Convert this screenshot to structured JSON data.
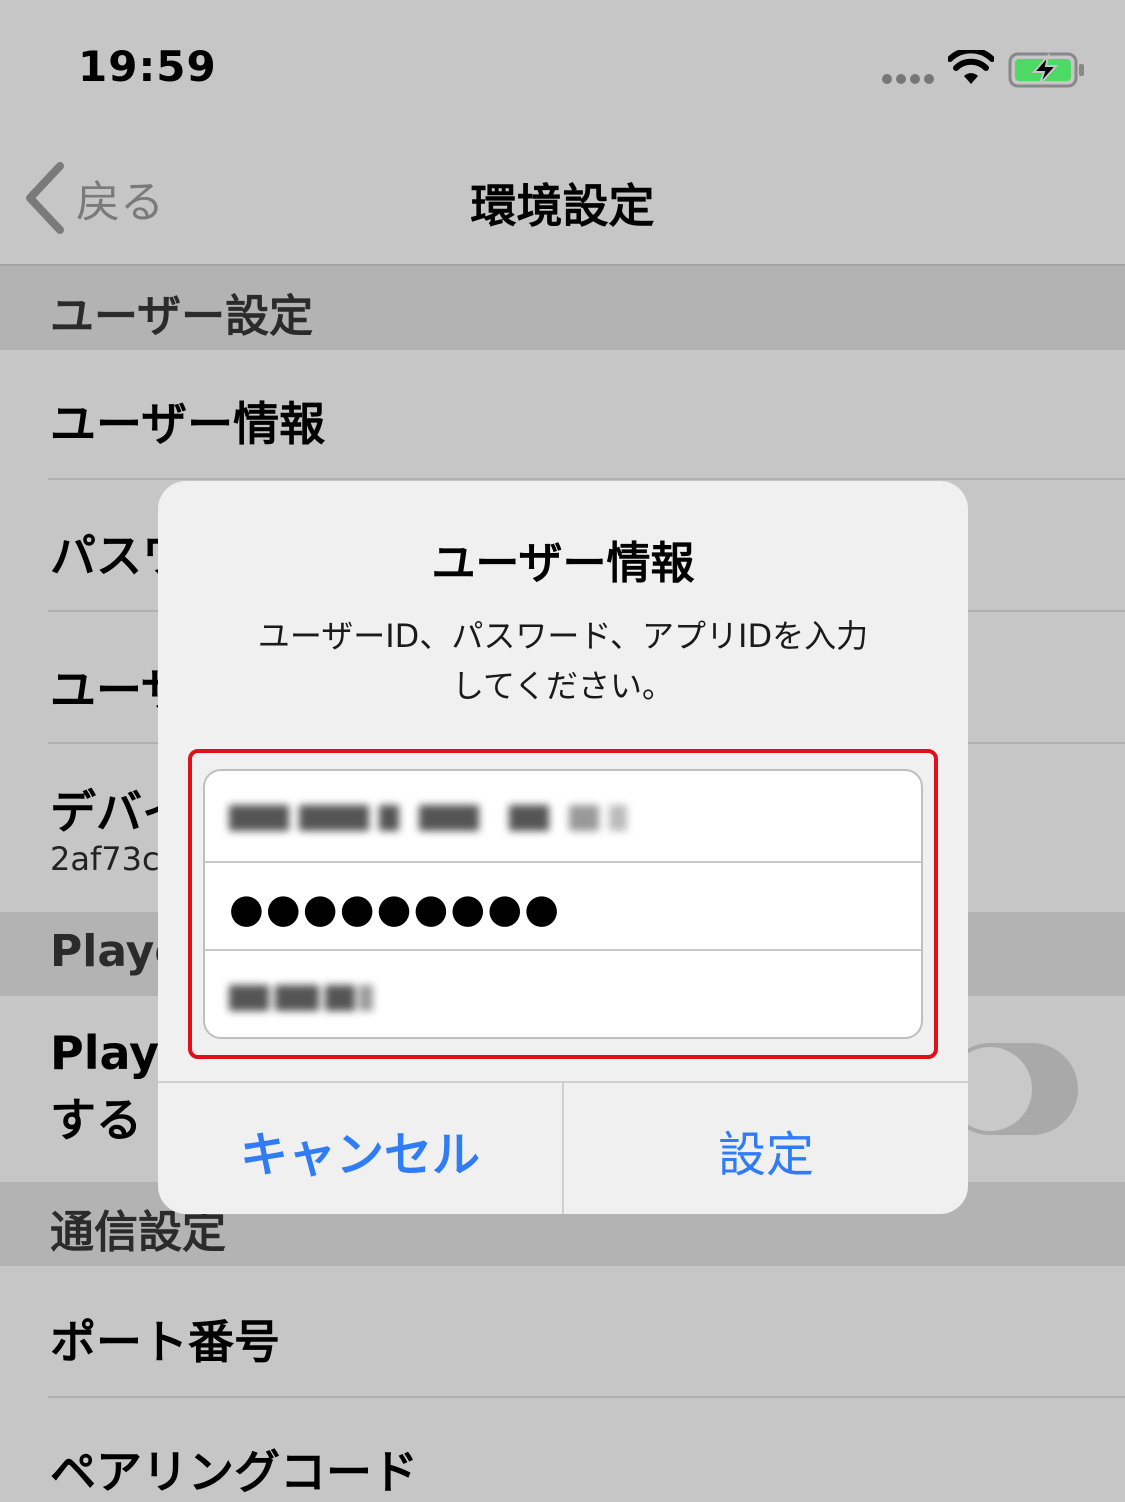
{
  "status_bar": {
    "time": "19:59",
    "battery_color": "#4cd964"
  },
  "nav": {
    "back_label": "戻る",
    "title": "環境設定"
  },
  "sections": {
    "user_settings": "ユーザー設定",
    "player": "Playe",
    "communication": "通信設定"
  },
  "rows": {
    "user_info": "ユーザー情報",
    "password": "パスワ",
    "user_third": "ユーザ",
    "device": "デバイ",
    "device_value": "2af73c",
    "player_toggle_line1": "Playe",
    "player_toggle_line2": "する",
    "port": "ポート番号",
    "pairing": "ペアリングコード"
  },
  "alert": {
    "title": "ユーザー情報",
    "message_line1": "ユーザーID、パスワード、アプリIDを入力",
    "message_line2": "してください。",
    "password_masked": "●●●●●●●●●",
    "cancel_label": "キャンセル",
    "confirm_label": "設定"
  },
  "colors": {
    "accent": "#2f7cf6",
    "highlight_border": "#e0101a"
  }
}
